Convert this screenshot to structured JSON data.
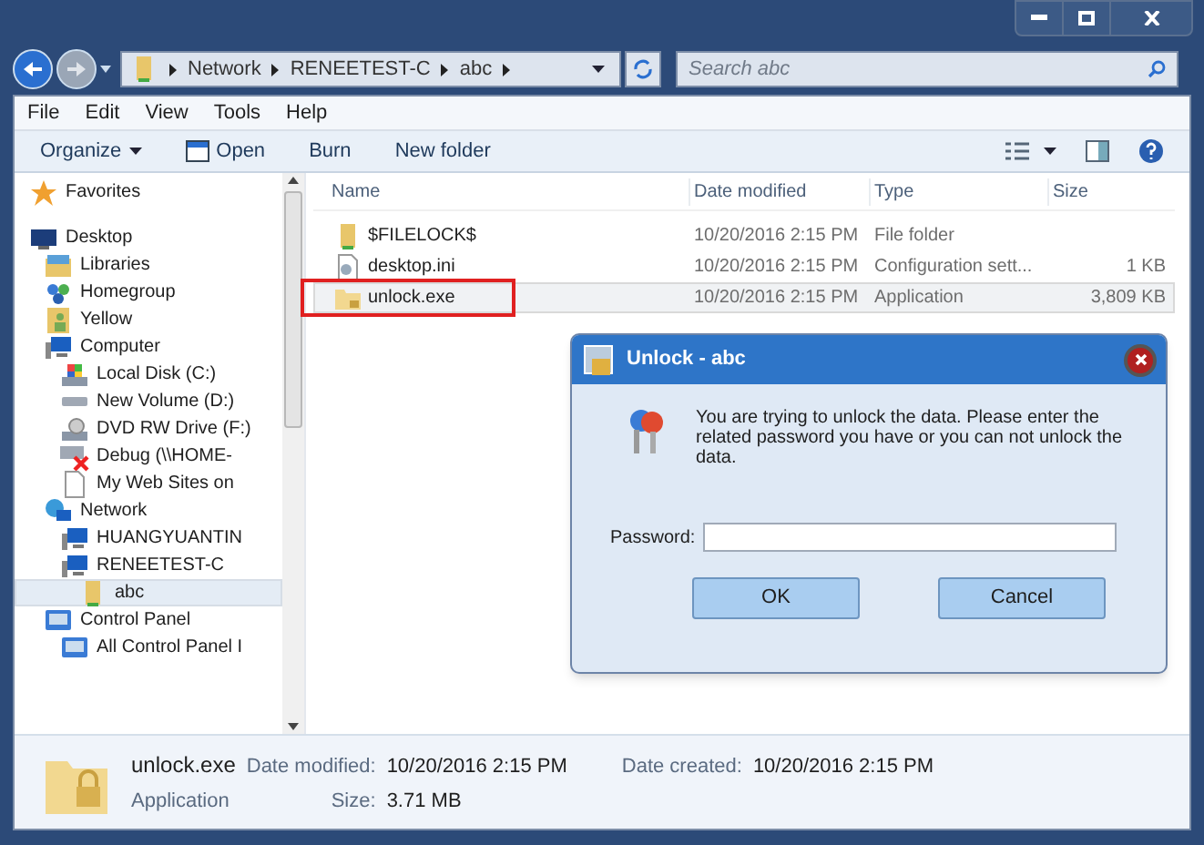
{
  "address_bar": {
    "path": [
      "Network",
      "RENEETEST-C",
      "abc"
    ]
  },
  "search": {
    "placeholder": "Search abc"
  },
  "menu": [
    "File",
    "Edit",
    "View",
    "Tools",
    "Help"
  ],
  "toolbar": [
    {
      "label": "Organize",
      "kind": "dropdown"
    },
    {
      "label": "Open",
      "kind": "icon"
    },
    {
      "label": "Burn",
      "kind": "plain"
    },
    {
      "label": "New folder",
      "kind": "plain"
    }
  ],
  "nav_tree": [
    {
      "label": "Favorites",
      "kind": "star",
      "selected": false
    },
    {
      "label": "Desktop",
      "kind": "desktop",
      "selected": false,
      "children": [
        {
          "label": "Libraries",
          "kind": "library",
          "selected": false
        },
        {
          "label": "Homegroup",
          "kind": "homegroup",
          "selected": false
        },
        {
          "label": "Yellow",
          "kind": "user",
          "selected": false
        },
        {
          "label": "Computer",
          "kind": "computer",
          "selected": false,
          "children": [
            {
              "label": "Local Disk (C:)",
              "kind": "disk",
              "selected": false
            },
            {
              "label": "New Volume (D:)",
              "kind": "drive",
              "selected": false
            },
            {
              "label": "DVD RW Drive (F:)",
              "kind": "dvd",
              "selected": false
            },
            {
              "label": "Debug (\\\\HOME-",
              "kind": "netdrive",
              "selected": false
            },
            {
              "label": "My Web Sites on ",
              "kind": "page",
              "selected": false
            }
          ]
        },
        {
          "label": "Network",
          "kind": "network",
          "selected": false,
          "children": [
            {
              "label": "HUANGYUANTIN",
              "kind": "computer",
              "selected": false
            },
            {
              "label": "RENEETEST-C",
              "kind": "computer",
              "selected": false,
              "children": [
                {
                  "label": "abc",
                  "kind": "folder",
                  "selected": true
                }
              ]
            }
          ]
        },
        {
          "label": "Control Panel",
          "kind": "panel",
          "selected": false,
          "children": [
            {
              "label": "All Control Panel I",
              "kind": "panel",
              "selected": false
            }
          ]
        }
      ]
    }
  ],
  "table": {
    "columns": [
      "Name",
      "Date modified",
      "Type",
      "Size"
    ],
    "rows": [
      {
        "name": "$FILELOCK$",
        "date": "10/20/2016 2:15 PM",
        "type": "File folder",
        "kind": "folder",
        "selected": false,
        "outlined": false
      },
      {
        "name": "desktop.ini",
        "date": "10/20/2016 2:15 PM",
        "type": "Configuration sett...",
        "size": "1 KB",
        "kind": "config",
        "selected": false,
        "outlined": false
      },
      {
        "name": "unlock.exe",
        "date": "10/20/2016 2:15 PM",
        "type": "Application",
        "size": "3,809 KB",
        "kind": "lockfolder",
        "selected": true,
        "outlined": true
      }
    ]
  },
  "dialog": {
    "title": "Unlock - abc",
    "message": "You are trying to unlock the data. Please enter the related password you have or you can not unlock the data.",
    "password_label": "Password:",
    "buttons": [
      "OK",
      "Cancel"
    ]
  },
  "details": {
    "name": "unlock.exe",
    "kind": "Application",
    "fields": [
      {
        "label": "Date modified:",
        "value": "10/20/2016 2:15 PM"
      },
      {
        "label": "Date created:",
        "value": "10/20/2016 2:15 PM"
      },
      {
        "label": "Size:",
        "value": "3.71 MB"
      }
    ]
  }
}
